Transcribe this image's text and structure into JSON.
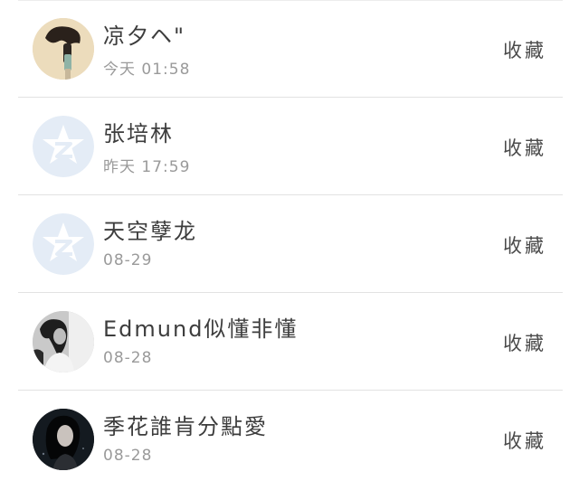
{
  "contacts": [
    {
      "name": "凉夕ヘ\"",
      "time": "今天 01:58",
      "action": "收藏",
      "avatar": "photo-avatar-1"
    },
    {
      "name": "张培林",
      "time": "昨天 17:59",
      "action": "收藏",
      "avatar": "qzone-default-avatar"
    },
    {
      "name": "天空孽龙",
      "time": "08-29",
      "action": "收藏",
      "avatar": "qzone-default-avatar"
    },
    {
      "name": "Edmund似懂非懂",
      "time": "08-28",
      "action": "收藏",
      "avatar": "photo-avatar-4"
    },
    {
      "name": "季花誰肯分點愛",
      "time": "08-28",
      "action": "收藏",
      "avatar": "photo-avatar-5"
    }
  ],
  "colors": {
    "name_text": "#3d3d3d",
    "time_text": "#9a9a9a",
    "divider": "#e2e2e2",
    "default_avatar_bg": "#e4ecf6",
    "default_avatar_fg": "#ffffff"
  }
}
